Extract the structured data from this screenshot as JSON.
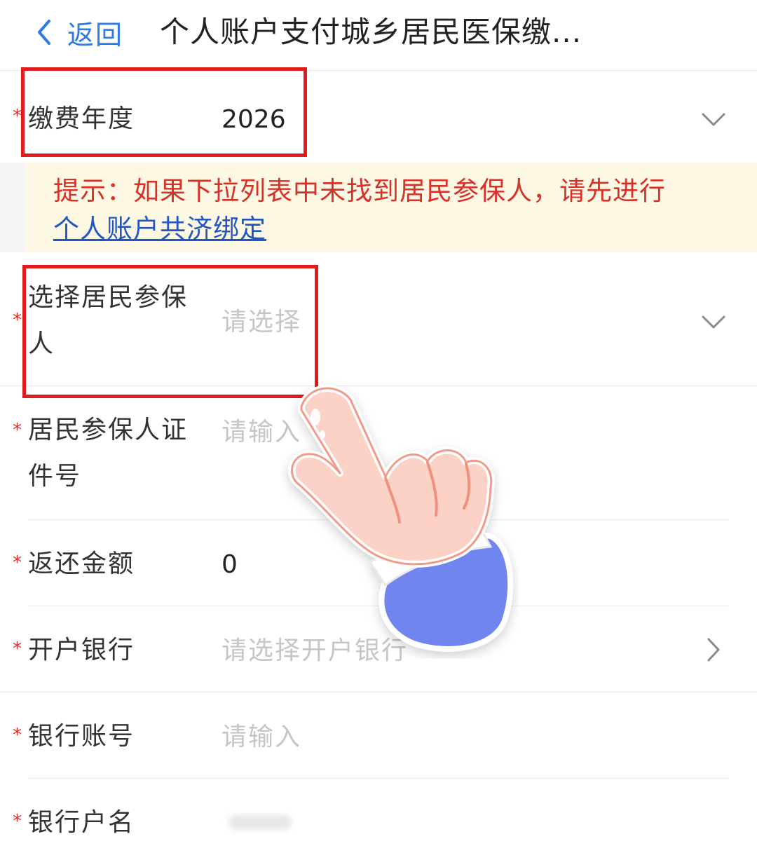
{
  "nav": {
    "back_label": "返回",
    "title": "个人账户支付城乡居民医保缴..."
  },
  "fields": {
    "year": {
      "required": "*",
      "label": "缴费年度",
      "value": "2026"
    },
    "insured": {
      "required": "*",
      "label": "选择居民参保人",
      "placeholder": "请选择"
    },
    "id_number": {
      "required": "*",
      "label": "居民参保人证件号",
      "placeholder": "请输入"
    },
    "refund_amount": {
      "required": "*",
      "label": "返还金额",
      "value": "0"
    },
    "bank": {
      "required": "*",
      "label": "开户银行",
      "placeholder": "请选择开户银行"
    },
    "bank_account": {
      "required": "*",
      "label": "银行账号",
      "placeholder": "请输入"
    },
    "account_name": {
      "required": "*",
      "label": "银行户名"
    }
  },
  "notice": {
    "text": "提示：如果下拉列表中未找到居民参保人，请先进行",
    "link": "个人账户共济绑定"
  },
  "colors": {
    "accent": "#2f7be6",
    "required": "#e0322a",
    "notice_text": "#d6322a",
    "notice_bg": "#fdf8e3",
    "highlight": "#e01b1b"
  },
  "icons": [
    "chevron-left-icon",
    "chevron-down-icon",
    "chevron-right-icon",
    "pointing-hand-icon"
  ]
}
